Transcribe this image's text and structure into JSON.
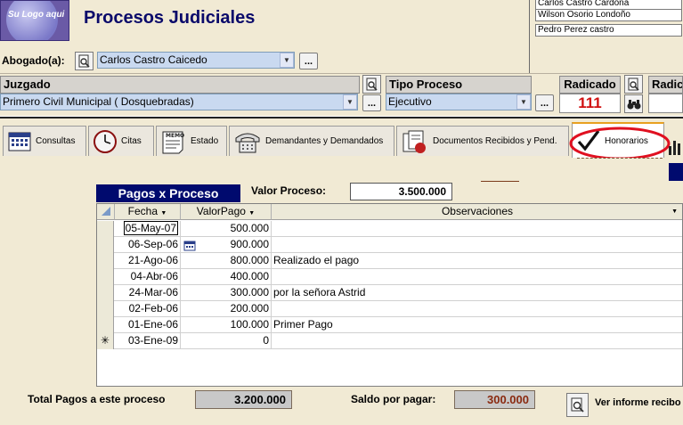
{
  "header": {
    "logo_text": "Su Logo aqui",
    "title": "Procesos Judiciales",
    "records": [
      "Carlos Castro Cardona",
      "Wilson Osorio Londoño",
      "Pedro Perez castro"
    ]
  },
  "abogado": {
    "label": "Abogado(a):",
    "value": "Carlos Castro Caicedo"
  },
  "juzgado": {
    "label": "Juzgado",
    "value": "Primero Civil Municipal  ( Dosquebradas)"
  },
  "tipo_proceso": {
    "label": "Tipo Proceso",
    "value": "Ejecutivo"
  },
  "radicado": {
    "label": "Radicado",
    "value": "111",
    "label2": "Radicado"
  },
  "ellipsis": "...",
  "tabs": [
    {
      "label": "Consultas",
      "icon": "calendar-icon"
    },
    {
      "label": "Citas",
      "icon": "clock-icon"
    },
    {
      "label": "Estado",
      "icon": "memo-icon"
    },
    {
      "label": "Demandantes y Demandados",
      "icon": "telephone-icon"
    },
    {
      "label": "Documentos Recibidos y Pend.",
      "icon": "documents-icon"
    },
    {
      "label": "Honorarios",
      "icon": "checkmark-icon",
      "active": true
    }
  ],
  "pagos": {
    "title": "Pagos x Proceso",
    "valor_label": "Valor Proceso:",
    "valor": "3.500.000",
    "columns": [
      "Fecha",
      "ValorPago",
      "Observaciones"
    ],
    "rows": [
      {
        "fecha": "05-May-07",
        "valor": "500.000",
        "obs": ""
      },
      {
        "fecha": "06-Sep-06",
        "valor": "900.000",
        "obs": ""
      },
      {
        "fecha": "21-Ago-06",
        "valor": "800.000",
        "obs": "Realizado el pago"
      },
      {
        "fecha": "04-Abr-06",
        "valor": "400.000",
        "obs": ""
      },
      {
        "fecha": "24-Mar-06",
        "valor": "300.000",
        "obs": "por la señora Astrid"
      },
      {
        "fecha": "02-Feb-06",
        "valor": "200.000",
        "obs": ""
      },
      {
        "fecha": "01-Ene-06",
        "valor": "100.000",
        "obs": "Primer Pago"
      }
    ],
    "new_row": {
      "marker": "✳",
      "fecha": "03-Ene-09",
      "valor": "0"
    }
  },
  "totals": {
    "total_label": "Total Pagos a este proceso",
    "total_value": "3.200.000",
    "saldo_label": "Saldo por pagar:",
    "saldo_value": "300.000",
    "informe_label": "Ver informe recibo"
  },
  "colors": {
    "accent_navy": "#000a6e",
    "radicado_red": "#d01010",
    "highlight_ellipse": "#e01020",
    "saldo_text": "#8a2a10"
  }
}
